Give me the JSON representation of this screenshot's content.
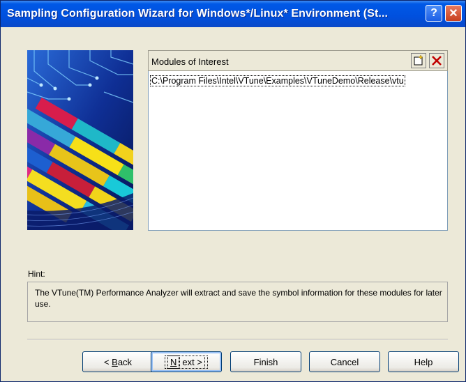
{
  "window": {
    "title": "Sampling Configuration Wizard for Windows*/Linux* Environment (St...",
    "help_button": "?",
    "close_button": "✕"
  },
  "modules": {
    "header": "Modules of Interest",
    "items": [
      "C:\\Program Files\\Intel\\VTune\\Examples\\VTuneDemo\\Release\\vtu"
    ]
  },
  "hint": {
    "label": "Hint:",
    "text": "The VTune(TM) Performance Analyzer will extract and save the symbol information for these modules for later use."
  },
  "buttons": {
    "back": {
      "prefix": "< ",
      "mnemonic": "B",
      "rest": "ack"
    },
    "next": {
      "mnemonic": "N",
      "rest": "ext >"
    },
    "finish": "Finish",
    "cancel": "Cancel",
    "help": "Help"
  },
  "colors": {
    "titlebar": "#0058e6",
    "dialog_bg": "#ece9d8",
    "delete_icon": "#c00000"
  }
}
